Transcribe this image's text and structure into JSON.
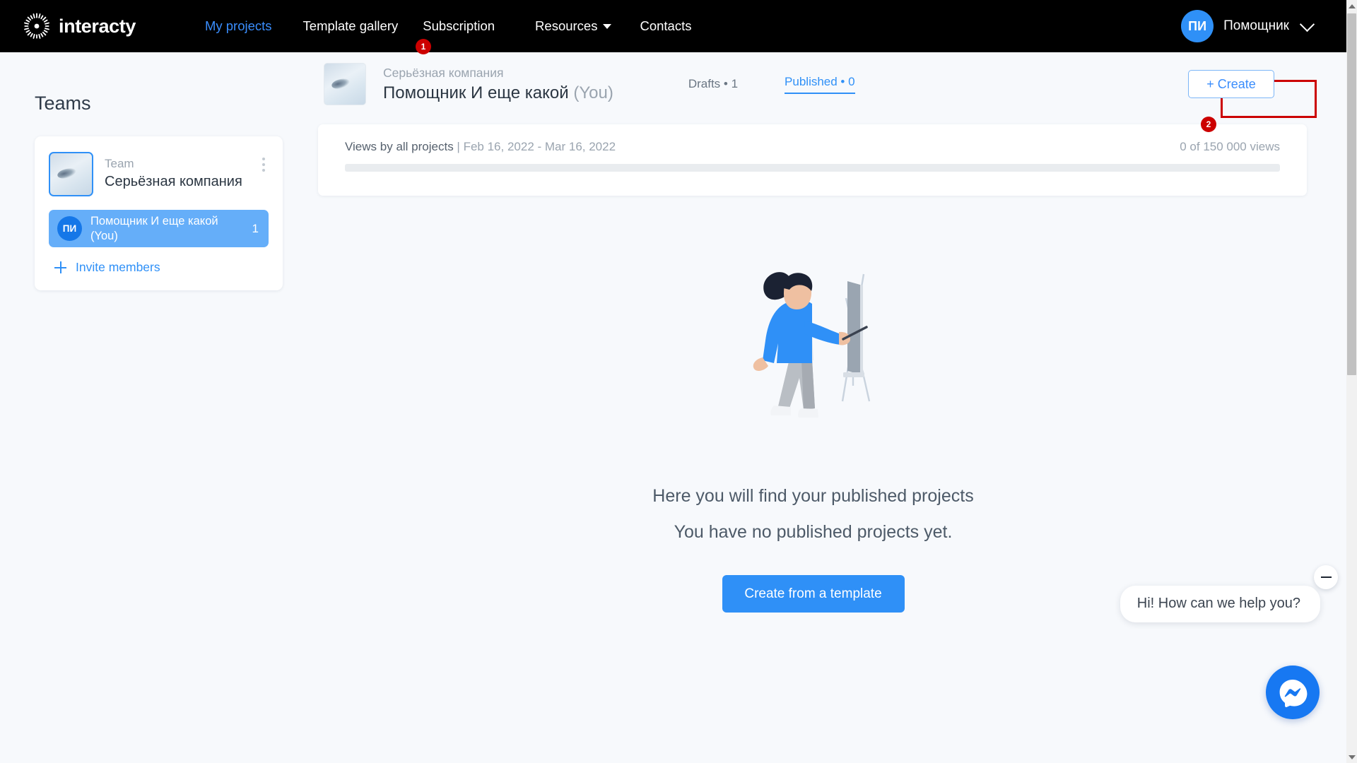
{
  "brand": {
    "name": "interacty",
    "logo_icon": "sunburst-logo-icon"
  },
  "nav": {
    "items": [
      {
        "label": "My projects",
        "style": "blue"
      },
      {
        "label": "Template gallery",
        "style": "white"
      },
      {
        "label": "Subscription",
        "style": "white"
      },
      {
        "label": "Resources",
        "style": "white",
        "has_dropdown": true
      },
      {
        "label": "Contacts",
        "style": "white"
      }
    ],
    "account": {
      "initials": "ПИ",
      "name": "Помощник",
      "chevron_icon": "chevron-down-icon"
    }
  },
  "annotations": [
    {
      "number": "1",
      "target": "Template gallery"
    },
    {
      "number": "2",
      "target": "+ Create"
    }
  ],
  "sidebar": {
    "title": "Teams",
    "team": {
      "role_label": "Team",
      "name": "Серьёзная компания",
      "menu_icon": "kebab-menu-icon",
      "thumbnail_icon": "team-photo-thumbnail"
    },
    "member": {
      "initials": "ПИ",
      "name": "Помощник И еще какой (You)",
      "count": "1"
    },
    "invite": {
      "label": "Invite members",
      "icon": "plus-icon"
    }
  },
  "project_header": {
    "thumbnail_icon": "project-photo-thumbnail",
    "company": "Серьёзная компания",
    "title": "Помощник И еще какой",
    "you_suffix": "(You)",
    "drafts": "Drafts • 1",
    "published": "Published  • 0",
    "create_button": "+ Create"
  },
  "views_card": {
    "label": "Views by all projects",
    "separator": " | ",
    "date_range": "Feb 16, 2022 - Mar 16, 2022",
    "quota": "0 of 150 000 views",
    "progress_percent": 0
  },
  "empty_state": {
    "illustration_icon": "woman-painting-easel-illustration",
    "line1": "Here you will find your published projects",
    "line2": "You have no published projects yet.",
    "cta": "Create from a template"
  },
  "chat": {
    "message": "Hi! How can we help you?",
    "minimize_icon": "minimize-icon",
    "fab_icon": "messenger-icon"
  },
  "colors": {
    "nav_bg": "#000000",
    "page_bg": "#f7f9fc",
    "accent_blue": "#2f90f7",
    "link_blue": "#3a8dfc",
    "highlight_red": "#cc0000",
    "member_row_blue": "#65aef9",
    "messenger_blue": "#1778f2"
  }
}
